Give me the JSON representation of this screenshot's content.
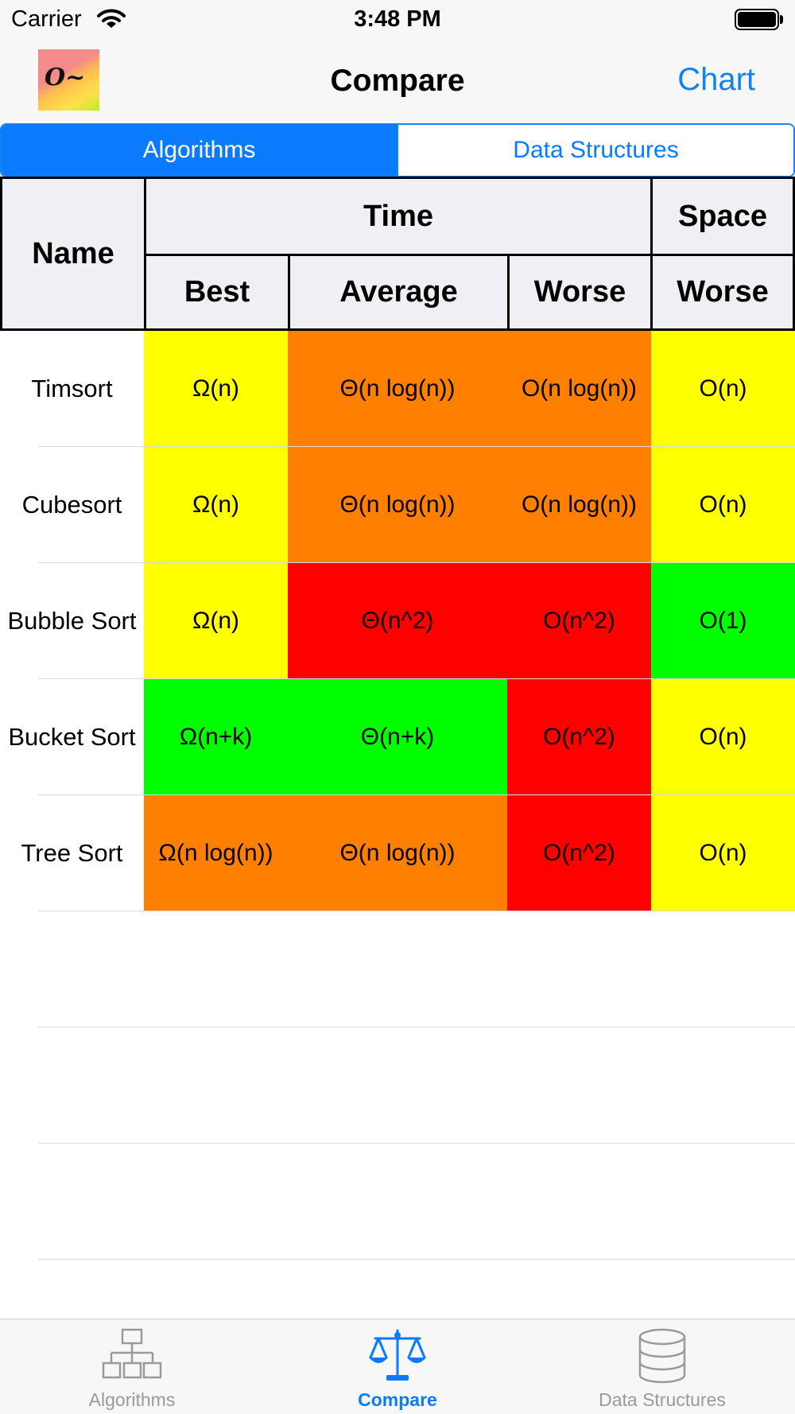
{
  "status": {
    "carrier": "Carrier",
    "time": "3:48 PM"
  },
  "nav": {
    "logo_text": "O~",
    "title": "Compare",
    "chart_button": "Chart"
  },
  "segments": {
    "algorithms": "Algorithms",
    "data_structures": "Data Structures",
    "selected": "Algorithms"
  },
  "table": {
    "headers": {
      "name": "Name",
      "time": "Time",
      "space": "Space",
      "best": "Best",
      "average": "Average",
      "time_worse": "Worse",
      "space_worse": "Worse"
    },
    "rows": [
      {
        "name": "Timsort",
        "best": "Ω(n)",
        "average": "Θ(n log(n))",
        "worse": "O(n log(n))",
        "space": "O(n)"
      },
      {
        "name": "Cubesort",
        "best": "Ω(n)",
        "average": "Θ(n log(n))",
        "worse": "O(n log(n))",
        "space": "O(n)"
      },
      {
        "name": "Bubble Sort",
        "best": "Ω(n)",
        "average": "Θ(n^2)",
        "worse": "O(n^2)",
        "space": "O(1)"
      },
      {
        "name": "Bucket Sort",
        "best": "Ω(n+k)",
        "average": "Θ(n+k)",
        "worse": "O(n^2)",
        "space": "O(n)"
      },
      {
        "name": "Tree Sort",
        "best": "Ω(n log(n))",
        "average": "Θ(n log(n))",
        "worse": "O(n^2)",
        "space": "O(n)"
      }
    ],
    "cell_colors": [
      {
        "best": "#ffff00",
        "average": "#ff7f00",
        "worse": "#ff7f00",
        "space": "#ffff00"
      },
      {
        "best": "#ffff00",
        "average": "#ff7f00",
        "worse": "#ff7f00",
        "space": "#ffff00"
      },
      {
        "best": "#ffff00",
        "average": "#ff0000",
        "worse": "#ff0000",
        "space": "#00ff00"
      },
      {
        "best": "#00ff00",
        "average": "#00ff00",
        "worse": "#ff0000",
        "space": "#ffff00"
      },
      {
        "best": "#ff7f00",
        "average": "#ff7f00",
        "worse": "#ff0000",
        "space": "#ffff00"
      }
    ]
  },
  "tabs": {
    "algorithms": "Algorithms",
    "compare": "Compare",
    "data_structures": "Data Structures",
    "selected": "Compare"
  },
  "colors": {
    "accent": "#0a7aff",
    "inactive_tab": "#9a9a9a"
  }
}
